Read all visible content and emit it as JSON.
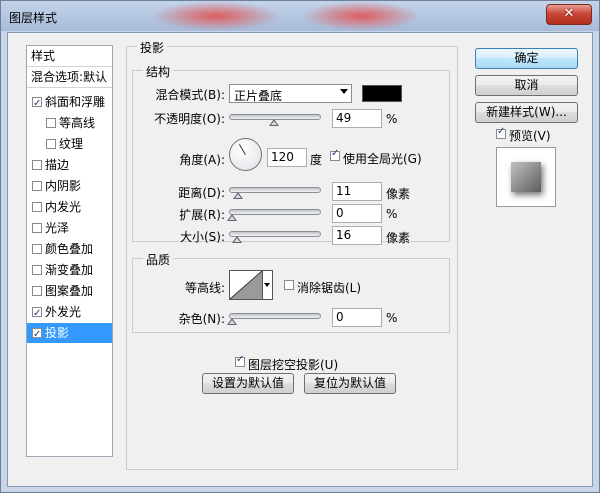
{
  "window": {
    "title": "图层样式"
  },
  "sidebar": {
    "header": "样式",
    "blend_options": "混合选项:默认",
    "items": [
      {
        "label": "斜面和浮雕",
        "checked": true
      },
      {
        "label": "等高线",
        "checked": false
      },
      {
        "label": "纹理",
        "checked": false
      },
      {
        "label": "描边",
        "checked": false
      },
      {
        "label": "内阴影",
        "checked": false
      },
      {
        "label": "内发光",
        "checked": false
      },
      {
        "label": "光泽",
        "checked": false
      },
      {
        "label": "颜色叠加",
        "checked": false
      },
      {
        "label": "渐变叠加",
        "checked": false
      },
      {
        "label": "图案叠加",
        "checked": false
      },
      {
        "label": "外发光",
        "checked": true
      },
      {
        "label": "投影",
        "checked": true,
        "selected": true
      }
    ]
  },
  "drop_shadow": {
    "section_title": "投影",
    "structure": {
      "title": "结构",
      "blend_mode_label": "混合模式(B):",
      "blend_mode_value": "正片叠底",
      "shadow_color": "#000000",
      "opacity_label": "不透明度(O):",
      "opacity_value": "49",
      "opacity_unit": "%",
      "opacity_fraction": 0.49,
      "angle_label": "角度(A):",
      "angle_value": "120",
      "angle_unit": "度",
      "global_light_label": "使用全局光(G)",
      "global_light_checked": true,
      "distance_label": "距离(D):",
      "distance_value": "11",
      "distance_unit": "像素",
      "spread_label": "扩展(R):",
      "spread_value": "0",
      "spread_unit": "%",
      "size_label": "大小(S):",
      "size_value": "16",
      "size_unit": "像素"
    },
    "quality": {
      "title": "品质",
      "contour_label": "等高线:",
      "antialias_label": "消除锯齿(L)",
      "antialias_checked": false,
      "noise_label": "杂色(N):",
      "noise_value": "0",
      "noise_unit": "%"
    },
    "knockout_label": "图层挖空投影(U)",
    "knockout_checked": true,
    "make_default_button": "设置为默认值",
    "reset_default_button": "复位为默认值"
  },
  "buttons": {
    "ok": "确定",
    "cancel": "取消",
    "new_style": "新建样式(W)..."
  },
  "preview": {
    "label": "预览(V)",
    "checked": true
  }
}
